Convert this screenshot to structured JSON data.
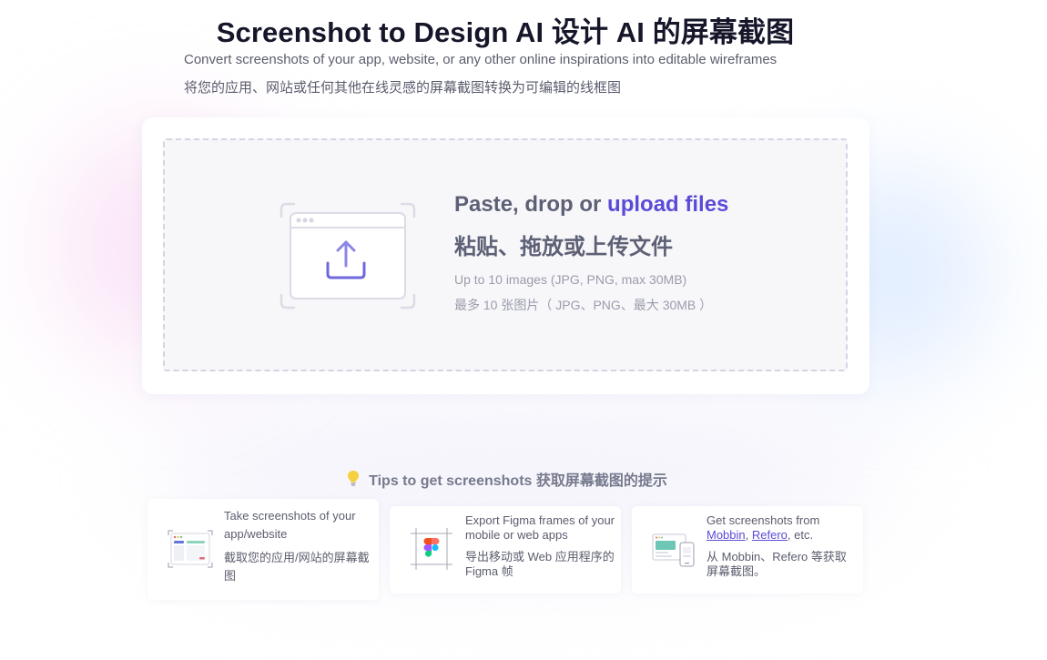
{
  "header": {
    "title": "Screenshot to Design AI 设计 AI 的屏幕截图",
    "subtitle_en": "Convert screenshots of your app, website, or any other online inspirations into editable wireframes",
    "subtitle_zh": "将您的应用、网站或任何其他在线灵感的屏幕截图转换为可编辑的线框图"
  },
  "dropzone": {
    "title_prefix": "Paste, drop or ",
    "upload_link": "upload files",
    "title_zh": "粘贴、拖放或上传文件",
    "limits_en": "Up to 10 images (JPG, PNG, max 30MB)",
    "limits_zh": "最多 10 张图片（ JPG、PNG、最大 30MB ）",
    "icon": "upload-icon"
  },
  "tips": {
    "heading": "Tips to get screenshots 获取屏幕截图的提示",
    "heading_icon": "lightbulb-icon",
    "items": [
      {
        "icon": "browser-screenshot-icon",
        "text_en": "Take screenshots of your app/website",
        "text_zh": "截取您的应用/网站的屏幕截图"
      },
      {
        "icon": "figma-icon",
        "text_en": "Export Figma frames of your mobile or web apps",
        "text_zh": "导出移动或 Web 应用程序的 Figma 帧"
      },
      {
        "icon": "devices-icon",
        "text_prefix": "Get screenshots from ",
        "link_1": "Mobbin",
        "separator": ", ",
        "link_2": "Refero",
        "text_suffix": ", etc.",
        "text_zh": "从 Mobbin、Refero 等获取屏幕截图。"
      }
    ]
  },
  "colors": {
    "accent": "#5b4bd6",
    "title": "#16162a",
    "muted": "#9a9cab",
    "dropzone_bg": "#f7f7fa",
    "dropzone_border": "#d5d3e6"
  }
}
